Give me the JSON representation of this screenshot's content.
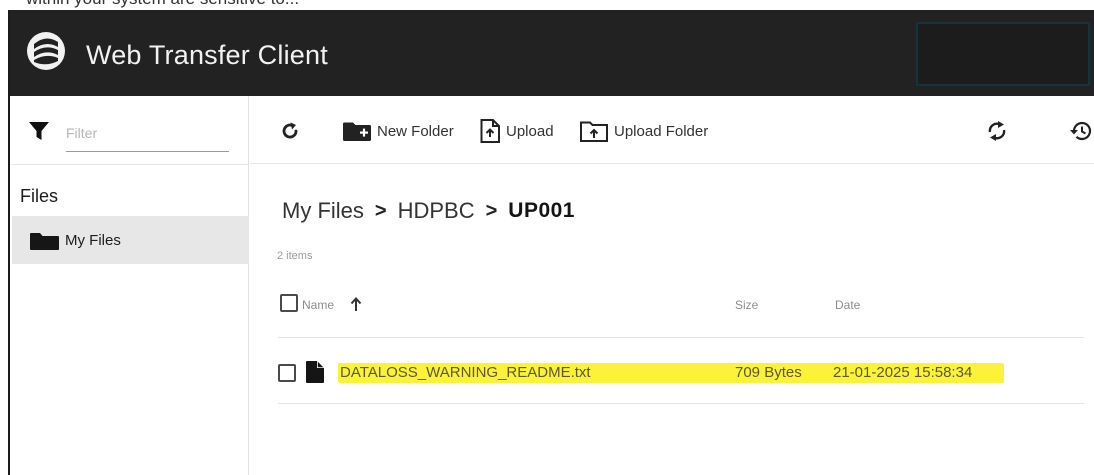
{
  "clipped_top_text": "within your system are sensitive to...",
  "header": {
    "title": "Web Transfer Client",
    "logo_icon": "client-logo-icon"
  },
  "sidebar": {
    "filter_placeholder": "Filter",
    "section_title": "Files",
    "items": [
      {
        "label": "My Files",
        "icon": "folder-icon",
        "active": true
      }
    ]
  },
  "toolbar": {
    "refresh_icon": "refresh-icon",
    "new_folder_label": "New Folder",
    "upload_label": "Upload",
    "upload_folder_label": "Upload Folder",
    "sync_icon": "sync-icon",
    "history_icon": "history-icon"
  },
  "breadcrumb": [
    "My Files",
    "HDPBC",
    "UP001"
  ],
  "item_count": "2 items",
  "table": {
    "columns": {
      "name": "Name",
      "size": "Size",
      "date": "Date"
    },
    "sort": "name-ascending",
    "rows": [
      {
        "name": "DATALOSS_WARNING_README.txt",
        "size": "709 Bytes",
        "date": "21-01-2025 15:58:34",
        "highlighted": true
      }
    ]
  },
  "colors": {
    "header_bg": "#222222",
    "active_nav_bg": "#e6e7e6",
    "highlight": "#fdf23a"
  }
}
